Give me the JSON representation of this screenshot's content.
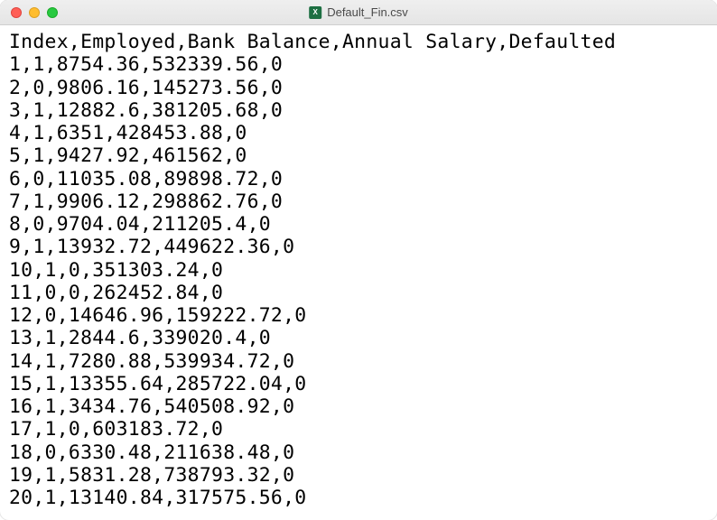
{
  "window": {
    "title": "Default_Fin.csv",
    "icon_label": "X"
  },
  "csv": {
    "header": "Index,Employed,Bank Balance,Annual Salary,Defaulted",
    "rows": [
      "1,1,8754.36,532339.56,0",
      "2,0,9806.16,145273.56,0",
      "3,1,12882.6,381205.68,0",
      "4,1,6351,428453.88,0",
      "5,1,9427.92,461562,0",
      "6,0,11035.08,89898.72,0",
      "7,1,9906.12,298862.76,0",
      "8,0,9704.04,211205.4,0",
      "9,1,13932.72,449622.36,0",
      "10,1,0,351303.24,0",
      "11,0,0,262452.84,0",
      "12,0,14646.96,159222.72,0",
      "13,1,2844.6,339020.4,0",
      "14,1,7280.88,539934.72,0",
      "15,1,13355.64,285722.04,0",
      "16,1,3434.76,540508.92,0",
      "17,1,0,603183.72,0",
      "18,0,6330.48,211638.48,0",
      "19,1,5831.28,738793.32,0",
      "20,1,13140.84,317575.56,0"
    ]
  }
}
